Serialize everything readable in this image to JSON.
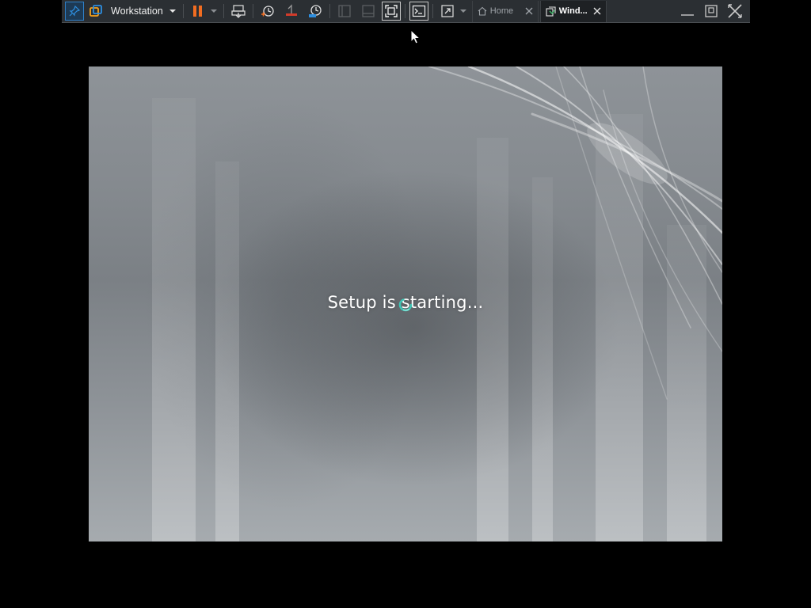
{
  "toolbar": {
    "menu_label": "Workstation",
    "tabs": [
      {
        "label": "Home",
        "icon": "home-icon"
      },
      {
        "label": "Wind...",
        "icon": "vm-icon"
      }
    ]
  },
  "vm_screen": {
    "status_text": "Setup is starting...",
    "spinner_color": "#3ec5b5"
  },
  "colors": {
    "toolbar_bg": "#2b2f33",
    "pause_accent": "#f26d21",
    "snapshot_accent": "#2e7fc7"
  }
}
